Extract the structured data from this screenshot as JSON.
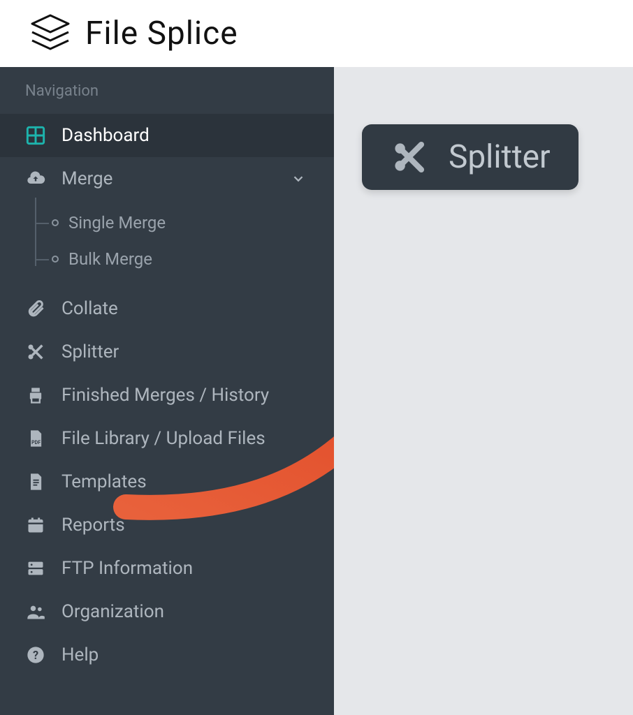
{
  "header": {
    "brand": "File Splice"
  },
  "sidebar": {
    "section_label": "Navigation",
    "items": [
      {
        "label": "Dashboard"
      },
      {
        "label": "Merge"
      },
      {
        "label": "Collate"
      },
      {
        "label": "Splitter"
      },
      {
        "label": "Finished Merges / History"
      },
      {
        "label": "File Library / Upload Files"
      },
      {
        "label": "Templates"
      },
      {
        "label": "Reports"
      },
      {
        "label": "FTP Information"
      },
      {
        "label": "Organization"
      },
      {
        "label": "Help"
      }
    ],
    "merge_children": [
      {
        "label": "Single Merge"
      },
      {
        "label": "Bulk Merge"
      }
    ]
  },
  "callout": {
    "label": "Splitter"
  }
}
